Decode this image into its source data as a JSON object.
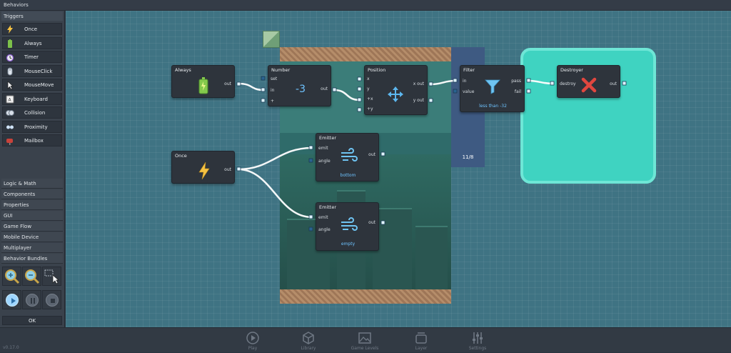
{
  "window_title": "Behaviors",
  "sidebar": {
    "triggers_header": "Triggers",
    "triggers": [
      {
        "label": "Once",
        "icon": "lightning-icon"
      },
      {
        "label": "Always",
        "icon": "battery-icon"
      },
      {
        "label": "Timer",
        "icon": "alarm-clock-icon"
      },
      {
        "label": "MouseClick",
        "icon": "mouse-icon"
      },
      {
        "label": "MouseMove",
        "icon": "cursor-icon"
      },
      {
        "label": "Keyboard",
        "icon": "key-icon"
      },
      {
        "label": "Collision",
        "icon": "collision-icon"
      },
      {
        "label": "Proximity",
        "icon": "proximity-icon"
      },
      {
        "label": "Mailbox",
        "icon": "mailbox-icon"
      }
    ],
    "categories": [
      "Logic & Math",
      "Components",
      "Properties",
      "GUI",
      "Game Flow",
      "Mobile Device",
      "Multiplayer",
      "Behavior Bundles"
    ],
    "ok_label": "OK"
  },
  "nodes": {
    "always": {
      "title": "Always",
      "out": "out"
    },
    "once": {
      "title": "Once",
      "out": "out"
    },
    "number": {
      "title": "Number",
      "inputs": [
        "set",
        "in",
        "+"
      ],
      "out": "out",
      "value": "-3"
    },
    "position": {
      "title": "Position",
      "inputs": [
        "x",
        "y",
        "+x",
        "+y"
      ],
      "outputs": [
        "x out",
        "y out"
      ]
    },
    "filter": {
      "title": "Filter",
      "inputs": [
        "in",
        "value"
      ],
      "outputs": [
        "pass",
        "fail"
      ],
      "condition": "less than -32"
    },
    "destroyer": {
      "title": "Destroyer",
      "inputs": [
        "destroy"
      ],
      "out": "out"
    },
    "emitter1": {
      "title": "Emitter",
      "inputs": [
        "emit",
        "angle"
      ],
      "out": "out",
      "direction": "bottom"
    },
    "emitter2": {
      "title": "Emitter",
      "inputs": [
        "emit",
        "angle"
      ],
      "out": "out",
      "direction": "empty"
    }
  },
  "game_preview": {
    "score": "11/8"
  },
  "bottom_nav": [
    "Play",
    "Library",
    "Game Levels",
    "Layer",
    "Settings"
  ],
  "version_label": "v0.17.0",
  "colors": {
    "canvas": "#3f7383",
    "accent": "#6ec3ff",
    "destroy_zone": "#3fd3c1"
  }
}
